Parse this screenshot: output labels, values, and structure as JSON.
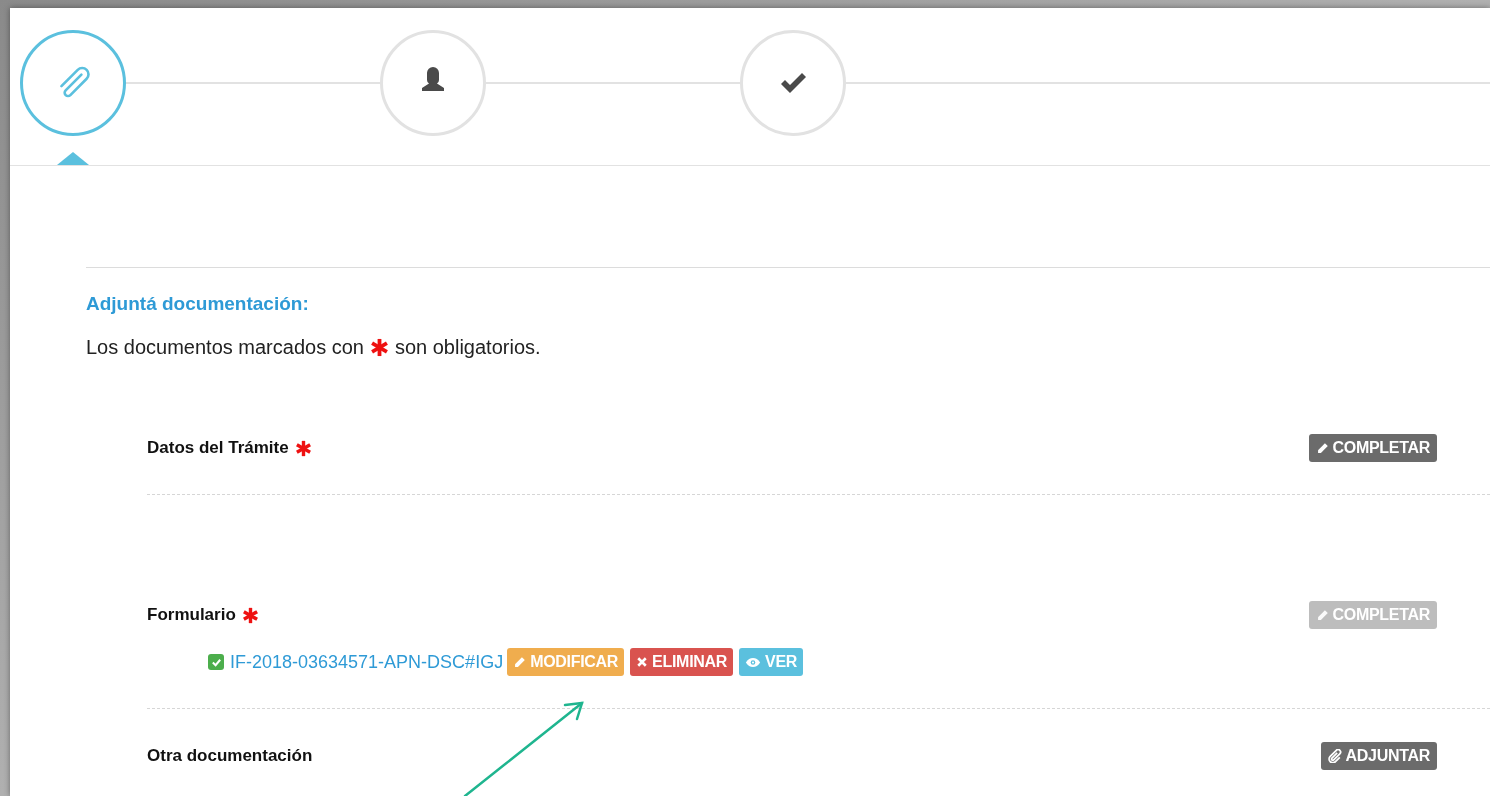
{
  "steps": [
    {
      "kind": "attach",
      "selected": true
    },
    {
      "kind": "person",
      "selected": false
    },
    {
      "kind": "check",
      "selected": false
    }
  ],
  "section": {
    "title": "Adjuntá documentación:",
    "note_before": "Los documentos marcados con",
    "note_after": "son obligatorios."
  },
  "documents": [
    {
      "title": "Datos del Trámite",
      "required": true,
      "action": {
        "kind": "edit",
        "label": "COMPLETAR",
        "disabled": false
      }
    },
    {
      "title": "Formulario",
      "required": true,
      "action": {
        "kind": "edit",
        "label": "COMPLETAR",
        "disabled": true
      },
      "files": [
        {
          "name": "IF-2018-03634571-APN-DSC#IGJ",
          "checked": true,
          "buttons": [
            {
              "kind": "modify",
              "label": "MODIFICAR"
            },
            {
              "kind": "delete",
              "label": "ELIMINAR"
            },
            {
              "kind": "view",
              "label": "VER"
            }
          ]
        }
      ]
    },
    {
      "title": "Otra documentación",
      "required": false,
      "action": {
        "kind": "attach",
        "label": "ADJUNTAR",
        "disabled": false
      }
    }
  ]
}
